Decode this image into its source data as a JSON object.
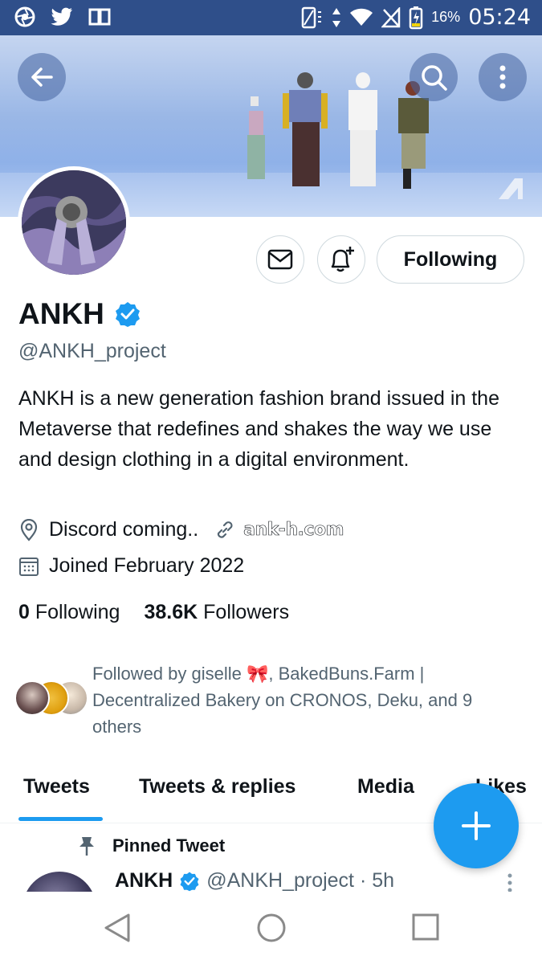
{
  "status_bar": {
    "battery_percent": "16%",
    "time": "05:24"
  },
  "profile": {
    "name": "ANKH",
    "handle": "@ANKH_project",
    "bio": "ANKH is a new generation fashion brand issued in the Metaverse that redefines and shakes the way we use and design clothing in a digital environment.",
    "location": "Discord coming..",
    "website": "ank-h.com",
    "joined": "Joined February 2022",
    "following_count": "0",
    "following_label": "Following",
    "followers_count": "38.6K",
    "followers_label": "Followers",
    "followed_by": "Followed by giselle 🎀, BakedBuns.Farm | Decentralized Bakery on CRONOS, Deku, and 9 others",
    "follow_button_label": "Following"
  },
  "tabs": [
    {
      "label": "Tweets",
      "active": true
    },
    {
      "label": "Tweets & replies",
      "active": false
    },
    {
      "label": "Media",
      "active": false
    },
    {
      "label": "Likes",
      "active": false
    }
  ],
  "pinned_tweet": {
    "label": "Pinned Tweet",
    "author": "ANKH",
    "handle_time": "@ANKH_project · 5h"
  },
  "colors": {
    "accent": "#1d9bf0",
    "status_bar": "#2f4f8a",
    "secondary_text": "#536471"
  },
  "icons": {
    "back": "arrow-left-icon",
    "search": "search-icon",
    "more": "more-vertical-icon",
    "message": "envelope-icon",
    "notify": "bell-plus-icon",
    "verified": "verified-badge-icon",
    "location": "location-pin-icon",
    "link": "link-icon",
    "calendar": "calendar-icon",
    "pin": "pin-icon",
    "compose": "plus-icon"
  }
}
